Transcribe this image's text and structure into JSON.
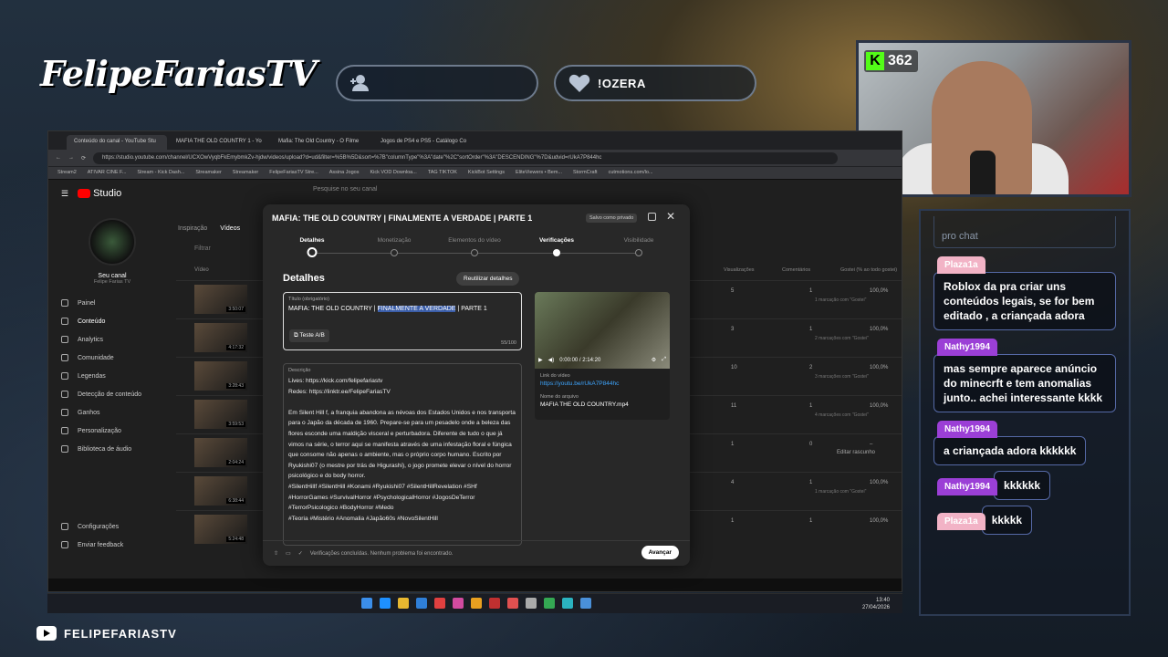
{
  "overlay": {
    "brand": "FelipeFariasTV",
    "follower_pill": "",
    "sub_pill": "!OZERA",
    "footer_name": "FELIPEFARIASTV",
    "viewer_count": "362",
    "accent": "#53fc18"
  },
  "chat": {
    "placeholder": "pro chat",
    "messages": [
      {
        "user": "Plaza1a",
        "text": "Roblox da pra criar uns conteúdos legais, se for bem editado , a criançada adora",
        "color": "#f2b3c6"
      },
      {
        "user": "Nathy1994",
        "text": "mas sempre aparece anúncio do minecrft e tem anomalias junto.. achei interessante kkkk",
        "color": "#9b3fd6"
      },
      {
        "user": "Nathy1994",
        "text": "a criançada adora kkkkkk",
        "color": "#9b3fd6"
      },
      {
        "user": "Nathy1994",
        "text": "kkkkkk",
        "color": "#9b3fd6"
      },
      {
        "user": "Plaza1a",
        "text": "kkkkk",
        "color": "#f2b3c6"
      }
    ]
  },
  "browser": {
    "tabs": [
      "Conteúdo do canal - YouTube Stu",
      "MAFIA THE OLD COUNTRY 1 - Yo",
      "Mafia: The Old Country - O Filme",
      "Jogos de PS4 e PS5 - Catálogo Co"
    ],
    "url": "https://studio.youtube.com/channel/UCXOwVyqbFkEmybmkZv-hjdw/videos/upload?d=ud&filter=%5B%5D&sort=%7B\"columnType\"%3A\"date\"%2C\"sortOrder\"%3A\"DESCENDING\"%7D&udvid=rUkA7P844hc",
    "bookmarks": [
      "Stream2",
      "ATIVAR CINE F...",
      "Stream - Kick Dash...",
      "Streamaker",
      "Streamaker",
      "FelipeFariasTV Stre...",
      "Assina Jogos",
      "Kick VOD Downloa...",
      "TAG TIKTOK",
      "KickBot Settings",
      "EliteViewers • Bem...",
      "StormCraft",
      "cutmotions.com/lo..."
    ]
  },
  "studio": {
    "logo": "Studio",
    "search_placeholder": "Pesquise no seu canal",
    "channel_label": "Seu canal",
    "channel_name": "Felipe Farias TV",
    "nav": [
      "Painel",
      "Conteúdo",
      "Analytics",
      "Comunidade",
      "Legendas",
      "Detecção de conteúdo",
      "Ganhos",
      "Personalização",
      "Biblioteca de áudio"
    ],
    "nav_bottom": [
      "Configurações",
      "Enviar feedback"
    ],
    "content_tabs": [
      "Inspiração",
      "Vídeos"
    ],
    "filter": "Filtrar",
    "col_video": "Vídeo",
    "columns": [
      "Visualizações",
      "Comentários",
      "Gostei (% ao todo gostei)"
    ],
    "rows": [
      {
        "dur": "3:50:07",
        "views": "5",
        "comments": "1",
        "likes": "100,0%",
        "sub": "1 marcação com \"Gostei\""
      },
      {
        "dur": "4:17:32",
        "views": "3",
        "comments": "1",
        "likes": "100,0%",
        "sub": "2 marcações com \"Gostei\""
      },
      {
        "dur": "3:28:43",
        "views": "10",
        "comments": "2",
        "likes": "100,0%",
        "sub": "3 marcações com \"Gostei\""
      },
      {
        "dur": "3:59:53",
        "views": "11",
        "comments": "1",
        "likes": "100,0%",
        "sub": "4 marcações com \"Gostei\""
      },
      {
        "dur": "2:04:24",
        "views": "1",
        "comments": "0",
        "likes": "–",
        "sub": ""
      },
      {
        "dur": "6:38:44",
        "views": "4",
        "comments": "1",
        "likes": "100,0%",
        "sub": "1 marcação com \"Gostei\""
      },
      {
        "dur": "5:24:48",
        "views": "1",
        "comments": "1",
        "likes": "100,0%",
        "sub": ""
      }
    ],
    "edit_draft": "Editar rascunho"
  },
  "dialog": {
    "title": "MAFIA: THE OLD COUNTRY | FINALMENTE A VERDADE | PARTE 1",
    "saved": "Salvo como privado",
    "steps": [
      "Detalhes",
      "Monetização",
      "Elementos do vídeo",
      "Verificações",
      "Visibilidade"
    ],
    "section": "Detalhes",
    "reuse": "Reutilizar detalhes",
    "title_label": "Título (obrigatório)",
    "title_pre": "MAFIA: THE OLD COUNTRY | ",
    "title_hl": "FINALMENTE A VERDADE",
    "title_post": " | PARTE 1",
    "ab_test": "Teste A/B",
    "count": "55/100",
    "desc_label": "Descrição",
    "description": "Lives: https://kick.com/felipefariastv\nRedes: https://linktr.ee/FelipeFariasTV\n\nEm Silent Hill f, a franquia abandona as névoas dos Estados Unidos e nos transporta para o Japão da década de 1960. Prepare-se para um pesadelo onde a beleza das flores esconde uma maldição visceral e perturbadora. Diferente de tudo o que já vimos na série, o terror aqui se manifesta através de uma infestação floral e fúngica que consome não apenas o ambiente, mas o próprio corpo humano. Escrito por Ryukishi07 (o mestre por trás de Higurashi), o jogo promete elevar o nível do horror psicológico e do body horror.\n#SilentHillf #SilentHill #Konami #Ryukishi07 #SilentHillRevelation #SHf #HorrorGames #SurvivalHorror #PsychologicalHorror #JogosDeTerror #TerrorPsicologico #BodyHorror #Medo\n#Teoria #Mistério #Anomalia #Japão60s #NovoSilentHill",
    "video_time": "0:00:00 / 2:14:20",
    "link_label": "Link do vídeo",
    "link": "https://youtu.be/rUkA7P844hc",
    "file_label": "Nome do arquivo",
    "file": "MAFIA THE OLD COUNTRY.mp4",
    "footer_status": "Verificações concluídas. Nenhum problema foi encontrado.",
    "next": "Avançar"
  },
  "taskbar": {
    "time": "13:40",
    "date": "27/04/2026"
  }
}
